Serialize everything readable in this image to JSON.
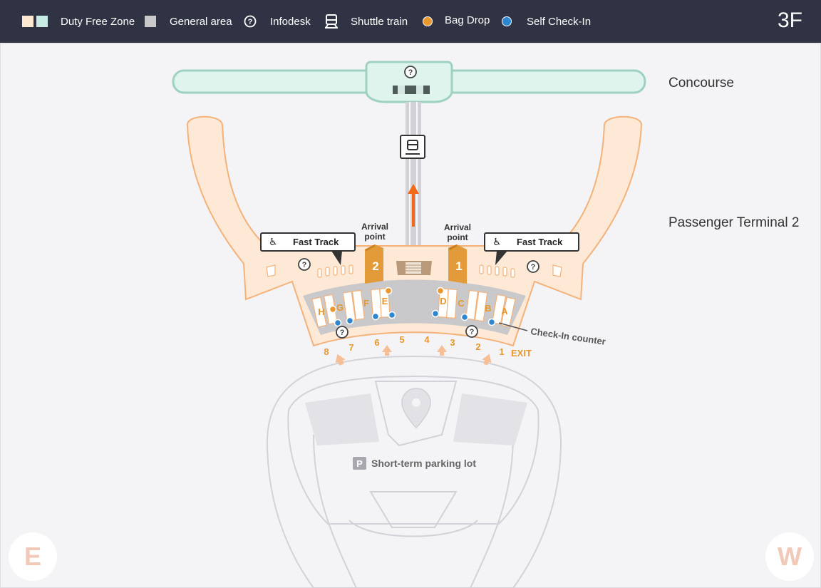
{
  "legend": {
    "duty_free": "Duty Free Zone",
    "general": "General area",
    "infodesk": "Infodesk",
    "shuttle": "Shuttle train",
    "bag_drop": "Bag Drop",
    "self_checkin": "Self Check-In",
    "floor": "3F"
  },
  "colors": {
    "duty_free_a": "#fde8d2",
    "duty_free_b": "#c8ece4",
    "general": "#c9c9cc",
    "bag_drop": "#e8982d",
    "self_checkin": "#2f86d0",
    "terminal_fill": "#fde9d5",
    "terminal_stroke": "#f4b27a",
    "concourse_fill": "#e0f4ee",
    "concourse_stroke": "#9fd1c3",
    "arrival_gate": "#e39b3a",
    "route_arrow": "#f16a1b",
    "header_bg": "#2f3344"
  },
  "labels": {
    "concourse": "Concourse",
    "terminal": "Passenger Terminal 2",
    "fast_track": "Fast Track",
    "arrival_point": [
      "Arrival",
      "point"
    ],
    "arrival_numbers": [
      "2",
      "1"
    ],
    "checkin_counter": "Check-In counter",
    "exit": "EXIT",
    "parking_icon": "P",
    "parking": "Short-term parking lot",
    "compass_left": "E",
    "compass_right": "W"
  },
  "counters": [
    "H",
    "G",
    "F",
    "E",
    "D",
    "C",
    "B",
    "A"
  ],
  "exits": [
    "8",
    "7",
    "6",
    "5",
    "4",
    "3",
    "2",
    "1"
  ],
  "icons": {
    "infodesk": "question-circle-icon",
    "shuttle": "train-icon",
    "fast_track": "wheelchair-icon",
    "parking": "pin-icon"
  }
}
